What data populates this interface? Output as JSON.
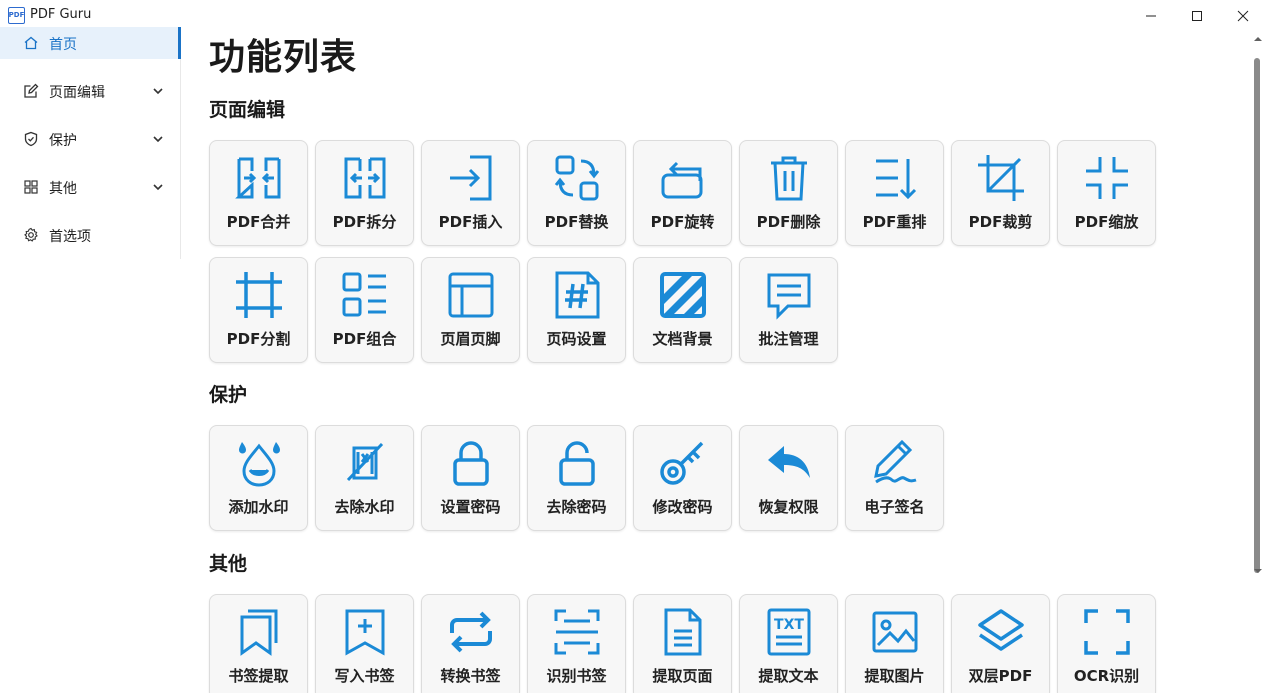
{
  "window": {
    "title": "PDF Guru",
    "logo_text": "PDF"
  },
  "colors": {
    "accent": "#1a73c7",
    "icon": "#1b8ad6",
    "card_bg": "#f7f7f7"
  },
  "sidebar": {
    "items": [
      {
        "label": "首页",
        "icon": "home-icon",
        "active": true
      },
      {
        "label": "页面编辑",
        "icon": "edit-icon",
        "expandable": true
      },
      {
        "label": "保护",
        "icon": "shield-icon",
        "expandable": true
      },
      {
        "label": "其他",
        "icon": "grid-icon",
        "expandable": true
      },
      {
        "label": "首选项",
        "icon": "gear-icon"
      }
    ]
  },
  "main": {
    "title": "功能列表",
    "sections": [
      {
        "title": "页面编辑",
        "cards": [
          {
            "label": "PDF合并",
            "icon": "merge-icon"
          },
          {
            "label": "PDF拆分",
            "icon": "split-icon"
          },
          {
            "label": "PDF插入",
            "icon": "insert-icon"
          },
          {
            "label": "PDF替换",
            "icon": "replace-icon"
          },
          {
            "label": "PDF旋转",
            "icon": "rotate-icon"
          },
          {
            "label": "PDF删除",
            "icon": "trash-icon"
          },
          {
            "label": "PDF重排",
            "icon": "reorder-icon"
          },
          {
            "label": "PDF裁剪",
            "icon": "crop-icon"
          },
          {
            "label": "PDF缩放",
            "icon": "scale-icon"
          },
          {
            "label": "PDF分割",
            "icon": "cut-grid-icon"
          },
          {
            "label": "PDF组合",
            "icon": "combine-icon"
          },
          {
            "label": "页眉页脚",
            "icon": "header-footer-icon"
          },
          {
            "label": "页码设置",
            "icon": "page-number-icon"
          },
          {
            "label": "文档背景",
            "icon": "background-icon"
          },
          {
            "label": "批注管理",
            "icon": "comment-icon"
          }
        ]
      },
      {
        "title": "保护",
        "cards": [
          {
            "label": "添加水印",
            "icon": "watermark-icon"
          },
          {
            "label": "去除水印",
            "icon": "remove-watermark-icon"
          },
          {
            "label": "设置密码",
            "icon": "lock-icon"
          },
          {
            "label": "去除密码",
            "icon": "unlock-icon"
          },
          {
            "label": "修改密码",
            "icon": "key-icon"
          },
          {
            "label": "恢复权限",
            "icon": "undo-icon"
          },
          {
            "label": "电子签名",
            "icon": "signature-icon"
          }
        ]
      },
      {
        "title": "其他",
        "cards": [
          {
            "label": "书签提取",
            "icon": "bookmark-extract-icon"
          },
          {
            "label": "写入书签",
            "icon": "bookmark-add-icon"
          },
          {
            "label": "转换书签",
            "icon": "convert-icon"
          },
          {
            "label": "识别书签",
            "icon": "scan-icon"
          },
          {
            "label": "提取页面",
            "icon": "document-icon"
          },
          {
            "label": "提取文本",
            "icon": "txt-icon"
          },
          {
            "label": "提取图片",
            "icon": "image-icon"
          },
          {
            "label": "双层PDF",
            "icon": "layers-icon"
          },
          {
            "label": "OCR识别",
            "icon": "ocr-icon"
          }
        ]
      }
    ]
  }
}
